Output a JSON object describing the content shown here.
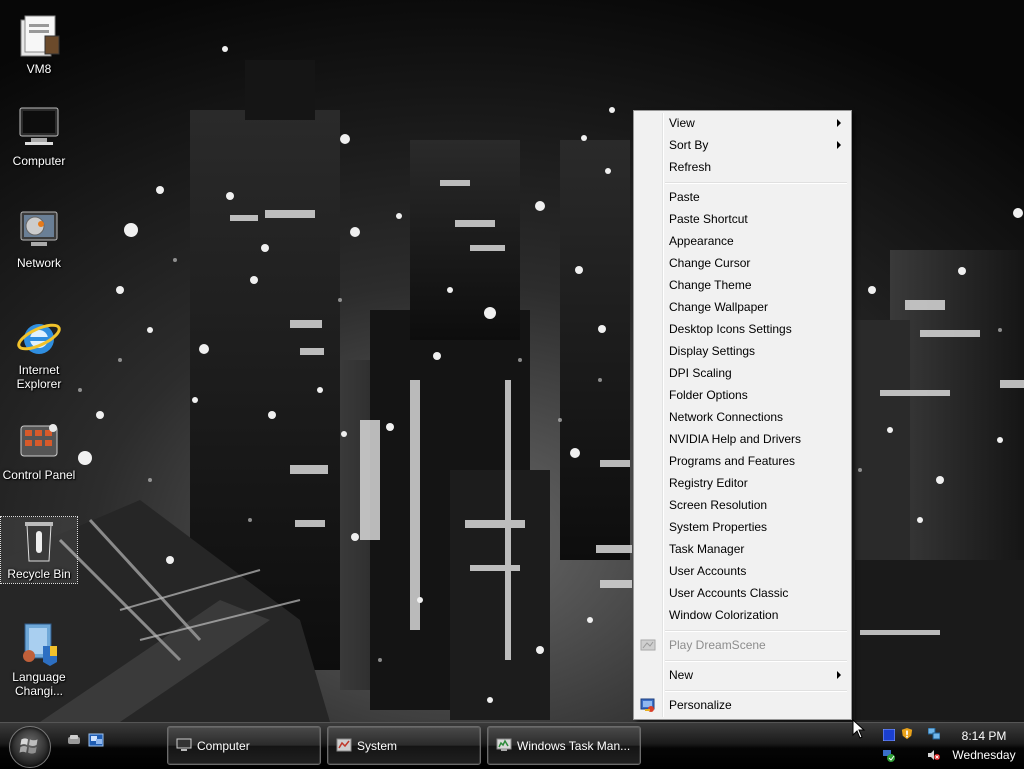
{
  "desktop": {
    "icons": [
      {
        "label": "VM8",
        "icon": "vm8-folder-icon"
      },
      {
        "label": "Computer",
        "icon": "computer-icon"
      },
      {
        "label": "Network",
        "icon": "network-icon"
      },
      {
        "label": "Internet Explorer",
        "icon": "internet-explorer-icon"
      },
      {
        "label": "Control Panel",
        "icon": "control-panel-icon"
      },
      {
        "label": "Recycle Bin",
        "icon": "recycle-bin-icon",
        "selected": true
      },
      {
        "label": "Language Changi...",
        "icon": "language-changer-icon"
      }
    ]
  },
  "context_menu": {
    "items": [
      {
        "label": "View",
        "submenu": true
      },
      {
        "label": "Sort By",
        "submenu": true
      },
      {
        "label": "Refresh"
      },
      {
        "label": "Paste"
      },
      {
        "label": "Paste Shortcut"
      },
      {
        "label": "Appearance"
      },
      {
        "label": "Change Cursor"
      },
      {
        "label": "Change Theme"
      },
      {
        "label": "Change Wallpaper"
      },
      {
        "label": "Desktop Icons Settings"
      },
      {
        "label": "Display Settings"
      },
      {
        "label": "DPI Scaling"
      },
      {
        "label": "Folder Options"
      },
      {
        "label": "Network Connections"
      },
      {
        "label": "NVIDIA Help and Drivers"
      },
      {
        "label": "Programs and Features"
      },
      {
        "label": "Registry Editor"
      },
      {
        "label": "Screen Resolution"
      },
      {
        "label": "System Properties"
      },
      {
        "label": "Task Manager"
      },
      {
        "label": "User Accounts"
      },
      {
        "label": "User Accounts Classic"
      },
      {
        "label": "Window Colorization"
      },
      {
        "label": "Play DreamScene",
        "disabled": true,
        "icon": "dreamscene-icon"
      },
      {
        "label": "New",
        "submenu": true
      },
      {
        "label": "Personalize",
        "icon": "personalize-icon"
      }
    ]
  },
  "taskbar": {
    "buttons": [
      {
        "label": "Computer",
        "icon": "computer-icon"
      },
      {
        "label": "System",
        "icon": "system-icon"
      },
      {
        "label": "Windows Task Man...",
        "icon": "task-manager-icon"
      }
    ],
    "tray_icons": [
      "square-icon",
      "security-shield-icon",
      "network-connection-icon",
      "update-icon",
      "volume-muted-icon"
    ],
    "clock": {
      "time": "8:14 PM",
      "day": "Wednesday"
    }
  }
}
